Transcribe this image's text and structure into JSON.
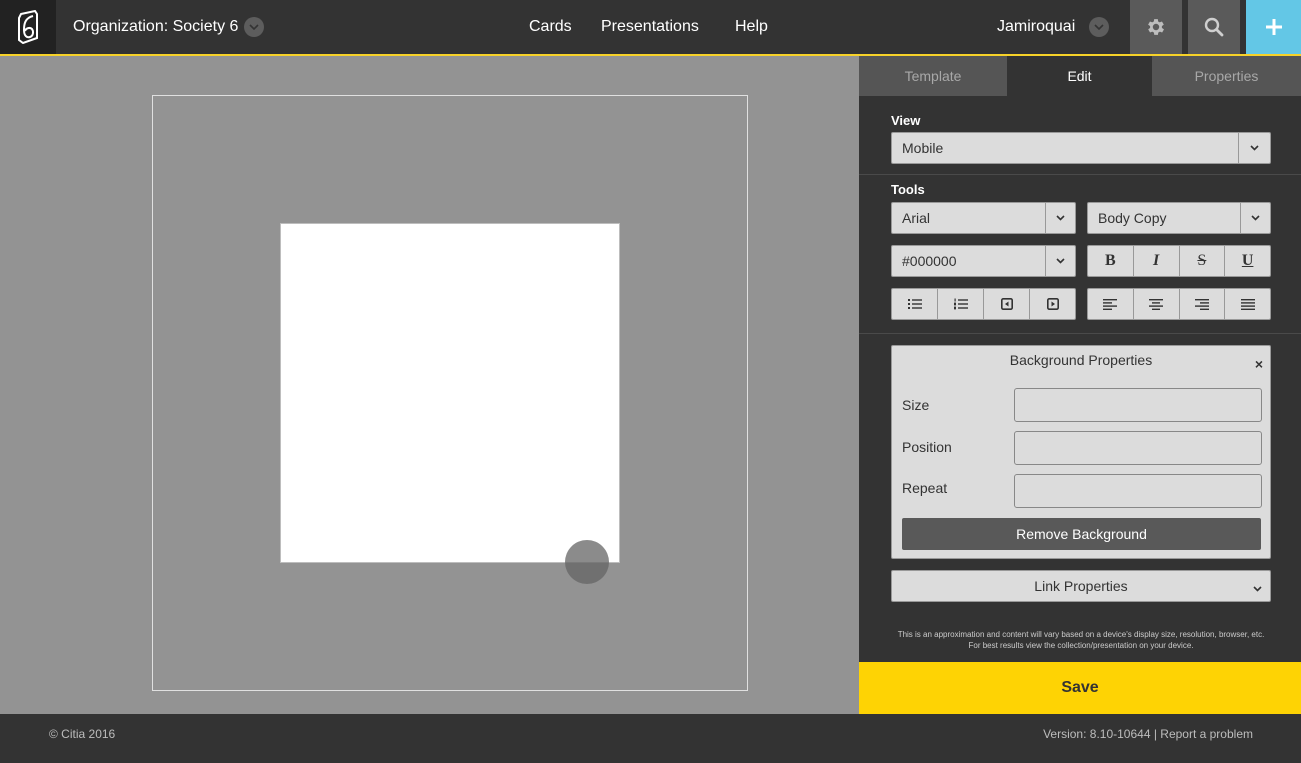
{
  "header": {
    "org_label": "Organization: Society 6",
    "nav": [
      "Cards",
      "Presentations",
      "Help"
    ],
    "user": "Jamiroquai",
    "accent": "#f7d229",
    "add_button_color": "#63c7e6",
    "icons": [
      "logo-icon",
      "chevron-down-icon",
      "gear-icon",
      "search-icon",
      "plus-icon"
    ]
  },
  "panel": {
    "tabs": [
      "Template",
      "Edit",
      "Properties"
    ],
    "active_tab": "Edit",
    "view_label": "View",
    "view_value": "Mobile",
    "tools_label": "Tools",
    "font_value": "Arial",
    "style_value": "Body Copy",
    "color_value": "#000000",
    "format_buttons": [
      "B",
      "I",
      "S",
      "U"
    ],
    "list_buttons": [
      "bulleted-list-icon",
      "numbered-list-icon",
      "outdent-icon",
      "indent-icon"
    ],
    "align_buttons": [
      "align-left-icon",
      "align-center-icon",
      "align-right-icon",
      "align-justify-icon"
    ],
    "background_properties": {
      "title": "Background Properties",
      "close": "×",
      "size_label": "Size",
      "position_label": "Position",
      "repeat_label": "Repeat",
      "remove_label": "Remove Background"
    },
    "link_properties_label": "Link Properties",
    "disclaimer": "This is an approximation and content will vary based on a device's display size, resolution, browser, etc. For best results view the collection/presentation on your device.",
    "save_label": "Save",
    "save_color": "#fed304"
  },
  "footer": {
    "copyright": "© Citia 2016",
    "version": "Version: 8.10-10644 | Report a problem"
  }
}
